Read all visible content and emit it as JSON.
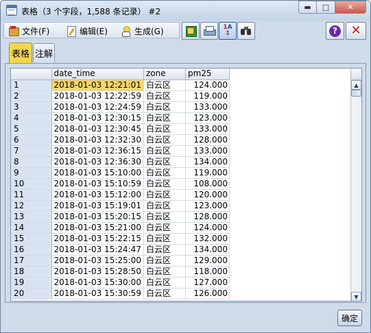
{
  "window": {
    "title": "表格（3 个字段，1,588 条记录） #2",
    "minimize_glyph": "▬",
    "maximize_glyph": "□",
    "close_glyph": "✕"
  },
  "menu": {
    "items": [
      {
        "label": "文件(F)",
        "icon": "file-menu-icon"
      },
      {
        "label": "编辑(E)",
        "icon": "edit-menu-icon"
      },
      {
        "label": "生成(G)",
        "icon": "generate-menu-icon"
      }
    ]
  },
  "toolbar": {
    "buttons": [
      "export-icon",
      "print-icon",
      "sort-icon",
      "find-icon"
    ],
    "help_glyph": "?",
    "close_glyph": "✕"
  },
  "tabs": [
    {
      "label": "表格",
      "active": true
    },
    {
      "label": "注解",
      "active": false
    }
  ],
  "table": {
    "columns": [
      "",
      "date_time",
      "zone",
      "pm25"
    ],
    "rows": [
      [
        "1",
        "2018-01-03 12:21:01",
        "白云区",
        "124.000"
      ],
      [
        "2",
        "2018-01-03 12:22:59",
        "白云区",
        "119.000"
      ],
      [
        "3",
        "2018-01-03 12:24:59",
        "白云区",
        "133.000"
      ],
      [
        "4",
        "2018-01-03 12:30:15",
        "白云区",
        "123.000"
      ],
      [
        "5",
        "2018-01-03 12:30:45",
        "白云区",
        "133.000"
      ],
      [
        "6",
        "2018-01-03 12:32:30",
        "白云区",
        "128.000"
      ],
      [
        "7",
        "2018-01-03 12:36:15",
        "白云区",
        "133.000"
      ],
      [
        "8",
        "2018-01-03 12:36:30",
        "白云区",
        "134.000"
      ],
      [
        "9",
        "2018-01-03 15:10:00",
        "白云区",
        "119.000"
      ],
      [
        "10",
        "2018-01-03 15:10:59",
        "白云区",
        "108.000"
      ],
      [
        "11",
        "2018-01-03 15:12:00",
        "白云区",
        "120.000"
      ],
      [
        "12",
        "2018-01-03 15:19:01",
        "白云区",
        "123.000"
      ],
      [
        "13",
        "2018-01-03 15:20:15",
        "白云区",
        "128.000"
      ],
      [
        "14",
        "2018-01-03 15:21:00",
        "白云区",
        "124.000"
      ],
      [
        "15",
        "2018-01-03 15:22:15",
        "白云区",
        "132.000"
      ],
      [
        "16",
        "2018-01-03 15:24:47",
        "白云区",
        "134.000"
      ],
      [
        "17",
        "2018-01-03 15:25:00",
        "白云区",
        "129.000"
      ],
      [
        "18",
        "2018-01-03 15:28:50",
        "白云区",
        "118.000"
      ],
      [
        "19",
        "2018-01-03 15:30:00",
        "白云区",
        "127.000"
      ],
      [
        "20",
        "2018-01-03 15:30:59",
        "白云区",
        "126.000"
      ]
    ],
    "selected_cell": {
      "row": 0,
      "col": 1
    }
  },
  "scrollbar": {
    "up_glyph": "▲",
    "down_glyph": "▼"
  },
  "footer": {
    "ok_label": "确定"
  }
}
